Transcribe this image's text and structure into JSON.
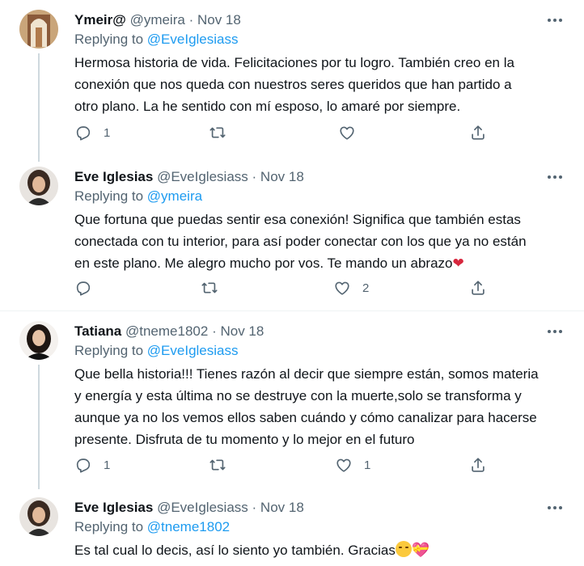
{
  "tweets": [
    {
      "name": "Ymeir@",
      "handle": "@ymeira",
      "sep": "·",
      "date": "Nov 18",
      "replying_prefix": "Replying to",
      "replying_to": "@EveIglesiass",
      "text_lines": [
        "Hermosa historia de vida. Felicitaciones por tu logro. También creo en la",
        "conexión que nos queda con nuestros seres queridos que han partido a",
        "otro plano. La he sentido con mí esposo, lo amaré por siempre."
      ],
      "reply_count": "1",
      "retweet_count": "",
      "like_count": ""
    },
    {
      "name": "Eve Iglesias",
      "handle": "@EveIglesiass",
      "sep": "·",
      "date": "Nov 18",
      "replying_prefix": "Replying to",
      "replying_to": "@ymeira",
      "text_lines": [
        "Que fortuna que puedas sentir esa conexión! Significa que también estas",
        "conectada con tu interior, para así poder conectar con los que ya no están",
        "en este plano. Me alegro mucho por vos. Te mando un abrazo"
      ],
      "reply_count": "",
      "retweet_count": "",
      "like_count": "2"
    },
    {
      "name": "Tatiana",
      "handle": "@tneme1802",
      "sep": "·",
      "date": "Nov 18",
      "replying_prefix": "Replying to",
      "replying_to": "@EveIglesiass",
      "text_lines": [
        "Que bella historia!!! Tienes razón al decir que siempre están, somos materia",
        "y energía y esta última no se destruye con la muerte,solo se transforma y",
        "aunque ya no los vemos ellos saben cuándo y cómo canalizar para hacerse",
        "presente. Disfruta de tu momento y lo mejor en el futuro"
      ],
      "reply_count": "1",
      "retweet_count": "",
      "like_count": "1"
    },
    {
      "name": "Eve Iglesias",
      "handle": "@EveIglesiass",
      "sep": "·",
      "date": "Nov 18",
      "replying_prefix": "Replying to",
      "replying_to": "@tneme1802",
      "text_lines": [
        "Es tal cual lo decis, así lo siento yo también. Gracias"
      ]
    }
  ],
  "emoji": {
    "heart": "❤",
    "hearts": "💝"
  },
  "icons": [
    "reply-icon",
    "retweet-icon",
    "like-icon",
    "share-icon",
    "more-icon"
  ],
  "colors": {
    "link": "#1d9bf0",
    "secondary": "#536471",
    "text": "#0f1419",
    "thread_line": "#cfd9de",
    "divider": "#eff3f4"
  }
}
